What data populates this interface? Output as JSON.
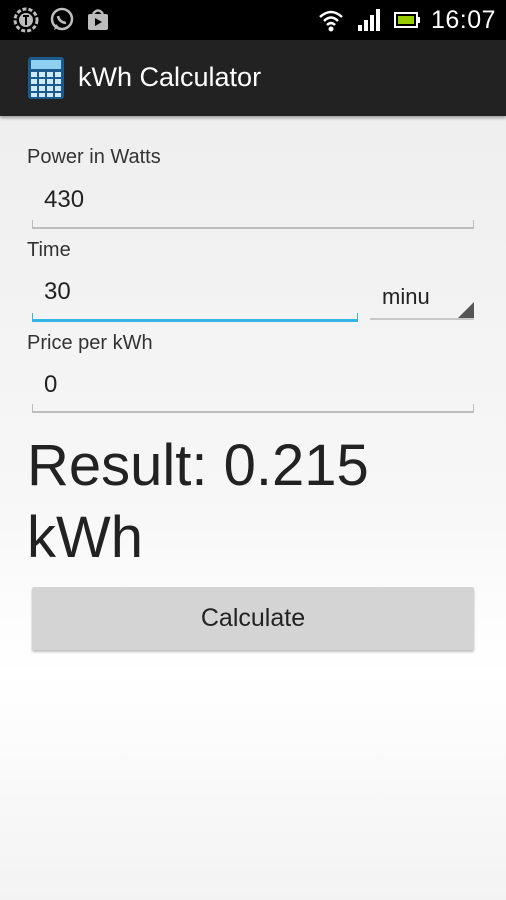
{
  "status_bar": {
    "time": "16:07",
    "left_icons": [
      "notification-app-icon",
      "whatsapp-icon",
      "play-store-icon"
    ],
    "right_icons": [
      "wifi-icon",
      "signal-icon",
      "battery-icon"
    ]
  },
  "action_bar": {
    "title": "kWh Calculator",
    "icon": "calculator-icon"
  },
  "form": {
    "power": {
      "label": "Power in Watts",
      "value": "430"
    },
    "time": {
      "label": "Time",
      "value": "30",
      "unit_selected": "minu"
    },
    "price": {
      "label": "Price per kWh",
      "value": "0"
    }
  },
  "result": {
    "text": "Result: 0.215 kWh"
  },
  "calculate_button": {
    "label": "Calculate"
  },
  "colors": {
    "accent": "#33b5e5",
    "action_bar": "#222222",
    "status_bar": "#000000"
  }
}
